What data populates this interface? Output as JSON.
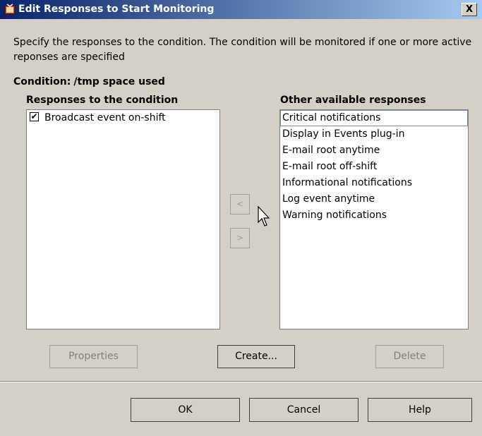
{
  "window": {
    "title": "Edit Responses to Start Monitoring",
    "close_label": "X"
  },
  "description": "Specify the responses to the condition. The condition will be monitored if one or more active reponses are specified",
  "condition": {
    "label": "Condition:",
    "value": "/tmp space used"
  },
  "responses": {
    "header": "Responses to the condition",
    "items": [
      {
        "label": "Broadcast event on-shift",
        "checked": true
      }
    ]
  },
  "available": {
    "header": "Other available responses",
    "items": [
      "Critical notifications",
      "Display in Events plug-in",
      "E-mail root anytime",
      "E-mail root off-shift",
      "Informational notifications",
      "Log event anytime",
      "Warning notifications"
    ]
  },
  "move_buttons": {
    "add_label": "<",
    "remove_label": ">"
  },
  "actions": {
    "properties_label": "Properties",
    "create_label": "Create...",
    "delete_label": "Delete"
  },
  "footer": {
    "ok_label": "OK",
    "cancel_label": "Cancel",
    "help_label": "Help"
  },
  "colors": {
    "titlebar_start": "#0a246a",
    "titlebar_end": "#a6caf0",
    "dialog_background": "#d4d0c8",
    "list_background": "#ffffff"
  }
}
